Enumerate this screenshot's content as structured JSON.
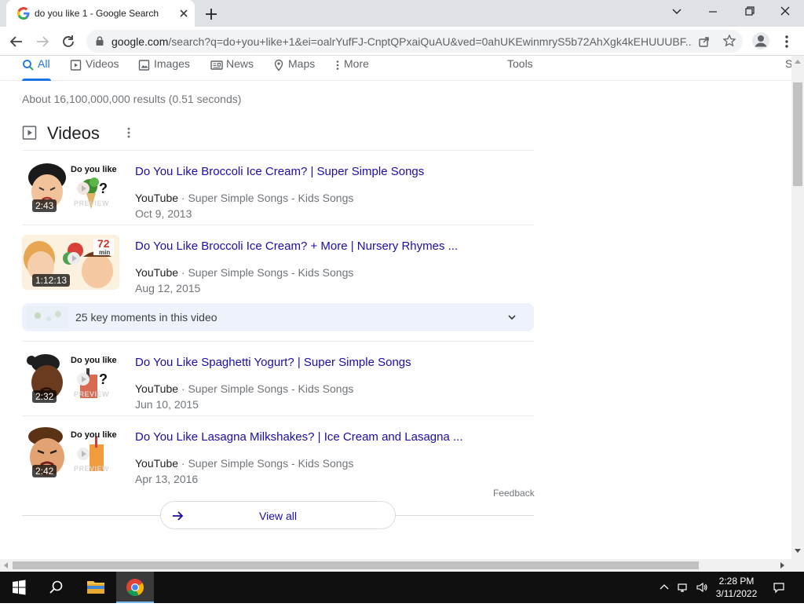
{
  "browser": {
    "tab_title": "do you like 1 - Google Search",
    "url_host": "google.com",
    "url_rest": "/search?q=do+you+like+1&ei=oalrYufFJ-CnptQPxaiQuAU&ved=0ahUKEwinmryS5b72AhXgk4kEHUUUBF..."
  },
  "search_tabs": [
    {
      "label": "All",
      "icon": "search-icon"
    },
    {
      "label": "Videos",
      "icon": "video-icon"
    },
    {
      "label": "Images",
      "icon": "image-icon"
    },
    {
      "label": "News",
      "icon": "news-icon"
    },
    {
      "label": "Maps",
      "icon": "map-pin-icon"
    },
    {
      "label": "More",
      "icon": "more-vertical-icon"
    }
  ],
  "tools_label": "Tools",
  "settings_label": "S",
  "result_stats": "About 16,100,000,000 results (0.51 seconds)",
  "videos_section": {
    "title": "Videos",
    "items": [
      {
        "title": "Do You Like Broccoli Ice Cream? | Super Simple Songs",
        "platform": "YouTube",
        "channel": "Super Simple Songs - Kids Songs",
        "date": "Oct 9, 2013",
        "duration": "2:43",
        "thumb_text": "Do you like",
        "thumb_preview": "PREVIEW"
      },
      {
        "title": "Do You Like Broccoli Ice Cream? + More | Nursery Rhymes ...",
        "platform": "YouTube",
        "channel": "Super Simple Songs - Kids Songs",
        "date": "Aug 12, 2015",
        "duration": "1:12:13",
        "thumb_badge": "72",
        "thumb_badge_unit": "min"
      },
      {
        "title": "Do You Like Spaghetti Yogurt? | Super Simple Songs",
        "platform": "YouTube",
        "channel": "Super Simple Songs - Kids Songs",
        "date": "Jun 10, 2015",
        "duration": "2:32",
        "thumb_text": "Do you like",
        "thumb_preview": "PREVIEW"
      },
      {
        "title": "Do You Like Lasagna Milkshakes? | Ice Cream and Lasagna ...",
        "platform": "YouTube",
        "channel": "Super Simple Songs - Kids Songs",
        "date": "Apr 13, 2016",
        "duration": "2:42",
        "thumb_text": "Do you like",
        "thumb_preview": "PREVIEW"
      }
    ],
    "key_moments": "25 key moments in this video",
    "separator": "·"
  },
  "feedback_label": "Feedback",
  "view_all_label": "View all",
  "taskbar": {
    "time": "2:28 PM",
    "date": "3/11/2022"
  },
  "colors": {
    "link": "#1a0dab",
    "accent": "#1a73e8",
    "muted": "#70757a"
  }
}
